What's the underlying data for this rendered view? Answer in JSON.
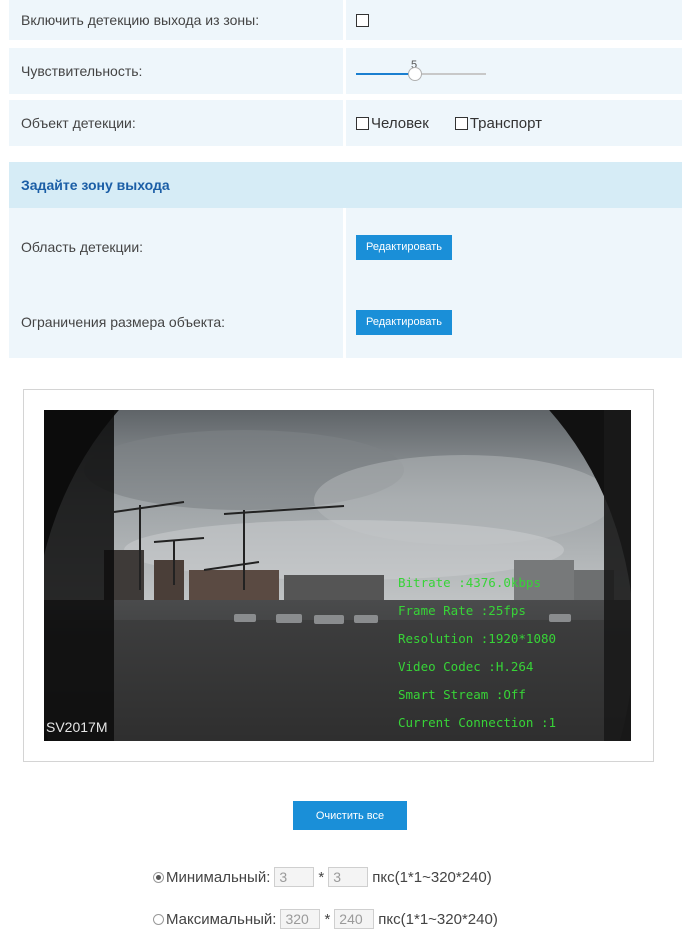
{
  "exit_detection": {
    "enable_label": "Включить детекцию выхода из зоны:",
    "enable_checked": false,
    "sensitivity_label": "Чувствительность:",
    "sensitivity_value": "5",
    "sensitivity_fraction": 0.45,
    "object_label": "Объект детекции:",
    "object_options": [
      {
        "label": "Человек",
        "checked": false
      },
      {
        "label": "Транспорт",
        "checked": false
      }
    ]
  },
  "exit_zone": {
    "header": "Задайте зону выхода",
    "detection_area_label": "Область детекции:",
    "detection_area_button": "Редактировать",
    "object_size_label": "Ограничения размера объекта:",
    "object_size_button": "Редактировать"
  },
  "video": {
    "camera_name": "SV2017M",
    "overlay": [
      "Bitrate :4376.0kbps",
      "Frame Rate :25fps",
      "Resolution :1920*1080",
      "Video Codec :H.264",
      "Smart Stream :Off",
      "Current Connection :1"
    ]
  },
  "clear_all_button": "Очистить все",
  "size_limits": {
    "min": {
      "label": "Минимальный:",
      "w": "3",
      "h": "3",
      "sep": "*",
      "unit": "пкс(1*1~320*240)",
      "selected": true
    },
    "max": {
      "label": "Максимальный:",
      "w": "320",
      "h": "240",
      "sep": "*",
      "unit": "пкс(1*1~320*240)",
      "selected": false
    }
  },
  "colors": {
    "accent": "#1a8fd8",
    "row_bg": "#eef6fb",
    "header_bg": "#d6ecf6",
    "overlay_text": "#37d437"
  }
}
